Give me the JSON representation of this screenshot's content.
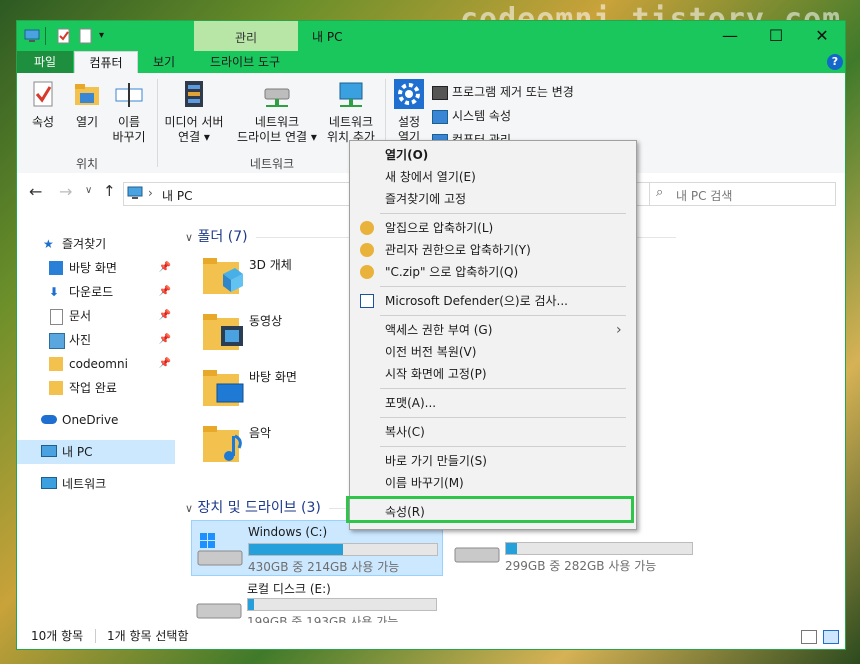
{
  "watermark": "codeomni.tistory.com",
  "titlebar": {
    "context_tab": "관리",
    "title": "내 PC",
    "minimize": "—",
    "maximize": "☐",
    "close": "✕"
  },
  "ribbon_tabs": {
    "file": "파일",
    "computer": "컴퓨터",
    "view": "보기",
    "drive_tools": "드라이브 도구",
    "help": "?"
  },
  "ribbon": {
    "properties": "속성",
    "open": "열기",
    "rename_line1": "이름",
    "rename_line2": "바꾸기",
    "group_location": "위치",
    "media_server_line1": "미디어 서버",
    "media_server_line2": "연결 ▾",
    "net_drive_line1": "네트워크",
    "net_drive_line2": "드라이브 연결 ▾",
    "net_location_line1": "네트워크",
    "net_location_line2": "위치 추가",
    "group_network": "네트워크",
    "settings_line1": "설정",
    "settings_line2": "열기",
    "uninstall": "프로그램 제거 또는 변경",
    "system_properties": "시스템 속성",
    "computer_manage": "컴퓨터 관리"
  },
  "address": {
    "path": "내 PC",
    "search_placeholder": "내 PC 검색"
  },
  "nav": {
    "quick_access": "즐겨찾기",
    "desktop": "바탕 화면",
    "downloads": "다운로드",
    "documents": "문서",
    "pictures": "사진",
    "codeomni": "codeomni",
    "done": "작업 완료",
    "onedrive": "OneDrive",
    "this_pc": "내 PC",
    "network": "네트워크"
  },
  "content": {
    "folders_header": "폴더 (7)",
    "folders": [
      "3D 개체",
      "동영상",
      "바탕 화면",
      "음악"
    ],
    "drives_header": "장치 및 드라이브 (3)",
    "drives": [
      {
        "name": "Windows (C:)",
        "free": "430GB 중 214GB 사용 가능",
        "used": 0.5
      },
      {
        "name": "",
        "free": "299GB 중 282GB 사용 가능",
        "used": 0.06
      },
      {
        "name": "로컬 디스크 (E:)",
        "free": "199GB 중 193GB 사용 가능",
        "used": 0.03
      }
    ]
  },
  "status": {
    "count": "10개 항목",
    "selected": "1개 항목 선택함"
  },
  "context_menu": {
    "open": "열기(O)",
    "open_new": "새 창에서 열기(E)",
    "pin_quick": "즐겨찾기에 고정",
    "alzip": "알집으로 압축하기(L)",
    "alzip_admin": "관리자 권한으로 압축하기(Y)",
    "alzip_named": "\"C.zip\" 으로 압축하기(Q)",
    "defender": "Microsoft Defender(으)로 검사...",
    "give_access": "액세스 권한 부여 (G)",
    "restore_prev": "이전 버전 복원(V)",
    "pin_start": "시작 화면에 고정(P)",
    "format": "포맷(A)...",
    "copy": "복사(C)",
    "shortcut": "바로 가기 만들기(S)",
    "rename": "이름 바꾸기(M)",
    "properties": "속성(R)"
  }
}
